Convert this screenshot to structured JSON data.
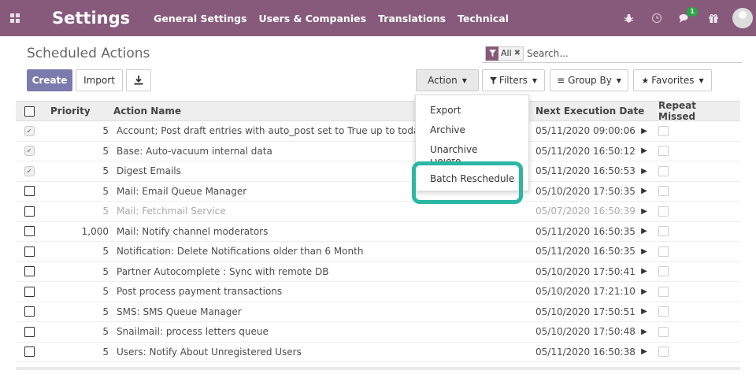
{
  "navbar": {
    "app_title": "Settings",
    "menu": [
      "General Settings",
      "Users & Companies",
      "Translations",
      "Technical"
    ],
    "chat_badge": "1",
    "brand_color": "#875a7b"
  },
  "control_panel": {
    "breadcrumb": "Scheduled Actions",
    "create_label": "Create",
    "import_label": "Import",
    "action_label": "Action",
    "filters_label": "Filters",
    "groupby_label": "Group By",
    "favorites_label": "Favorites",
    "facet_label": "All",
    "search_placeholder": "Search..."
  },
  "action_menu": {
    "items": [
      "Export",
      "Archive",
      "Unarchive",
      "Delete",
      "Batch Reschedule"
    ],
    "highlight_color": "#2ab7a3"
  },
  "table": {
    "headers": {
      "priority": "Priority",
      "name": "Action Name",
      "next_date": "Next Execution Date",
      "repeat": "Repeat Missed"
    },
    "rows": [
      {
        "priority": "5",
        "name": "Account; Post draft entries with auto_post set to True up to today",
        "next_date": "05/11/2020 09:00:06",
        "selected": true,
        "active": true
      },
      {
        "priority": "5",
        "name": "Base: Auto-vacuum internal data",
        "next_date": "05/11/2020 16:50:12",
        "selected": true,
        "active": true
      },
      {
        "priority": "5",
        "name": "Digest Emails",
        "next_date": "05/11/2020 16:50:53",
        "selected": true,
        "active": true
      },
      {
        "priority": "5",
        "name": "Mail: Email Queue Manager",
        "next_date": "05/10/2020 17:50:35",
        "selected": false,
        "active": true
      },
      {
        "priority": "5",
        "name": "Mail: Fetchmail Service",
        "next_date": "05/07/2020 16:50:39",
        "selected": false,
        "active": false
      },
      {
        "priority": "1,000",
        "name": "Mail: Notify channel moderators",
        "next_date": "05/11/2020 16:50:35",
        "selected": false,
        "active": true
      },
      {
        "priority": "5",
        "name": "Notification: Delete Notifications older than 6 Month",
        "next_date": "05/11/2020 16:50:35",
        "selected": false,
        "active": true
      },
      {
        "priority": "5",
        "name": "Partner Autocomplete : Sync with remote DB",
        "next_date": "05/10/2020 17:50:41",
        "selected": false,
        "active": true
      },
      {
        "priority": "5",
        "name": "Post process payment transactions",
        "next_date": "05/10/2020 17:21:10",
        "selected": false,
        "active": true
      },
      {
        "priority": "5",
        "name": "SMS: SMS Queue Manager",
        "next_date": "05/10/2020 17:50:51",
        "selected": false,
        "active": true
      },
      {
        "priority": "5",
        "name": "Snailmail: process letters queue",
        "next_date": "05/10/2020 17:50:48",
        "selected": false,
        "active": true
      },
      {
        "priority": "5",
        "name": "Users: Notify About Unregistered Users",
        "next_date": "05/11/2020 16:50:38",
        "selected": false,
        "active": true
      }
    ]
  }
}
